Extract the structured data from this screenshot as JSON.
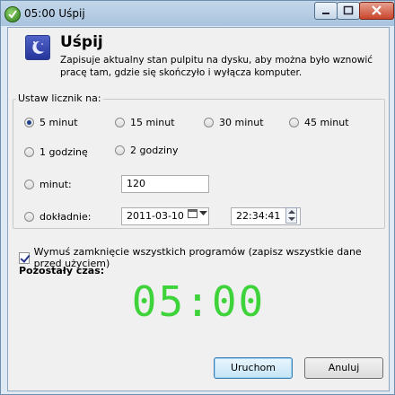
{
  "window": {
    "title": "05:00 Uśpij"
  },
  "header": {
    "title": "Uśpij",
    "description": "Zapisuje aktualny stan pulpitu na dysku, aby można było wznowić pracę tam, gdzie się skończyło i wyłącza komputer."
  },
  "timer_group": {
    "legend": "Ustaw licznik na:",
    "options": [
      {
        "label": "5 minut",
        "checked": true
      },
      {
        "label": "15 minut",
        "checked": false
      },
      {
        "label": "30 minut",
        "checked": false
      },
      {
        "label": "45 minut",
        "checked": false
      },
      {
        "label": "1 godzinę",
        "checked": false
      },
      {
        "label": "2 godziny",
        "checked": false
      }
    ],
    "minutes": {
      "label": "minut:",
      "value": "120"
    },
    "exact": {
      "label": "dokładnie:",
      "date": "2011-03-10",
      "time": "22:34:41"
    }
  },
  "force_close": {
    "label": "Wymuś zamknięcie wszystkich programów (zapisz wszystkie dane przed użyciem)",
    "checked": true
  },
  "remaining": {
    "label": "Pozostały czas:",
    "value": "05:00"
  },
  "buttons": {
    "start": "Uruchom",
    "cancel": "Anuluj"
  },
  "colors": {
    "timer": "#3fd33b",
    "accent": "#26359b"
  }
}
